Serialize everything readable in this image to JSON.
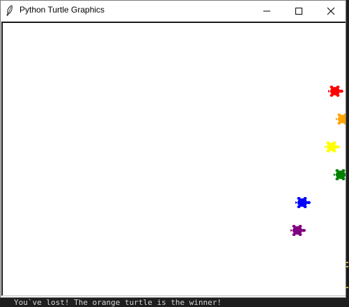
{
  "window": {
    "title": "Python Turtle Graphics"
  },
  "titlebar_icons": {
    "app": "feather-icon",
    "minimize": "minimize-icon",
    "maximize": "maximize-icon",
    "close": "close-icon"
  },
  "turtles": [
    {
      "name": "red",
      "color": "#ff0000"
    },
    {
      "name": "orange",
      "color": "#ffa500"
    },
    {
      "name": "yellow",
      "color": "#ffff00"
    },
    {
      "name": "green",
      "color": "#008000"
    },
    {
      "name": "blue",
      "color": "#0000ff"
    },
    {
      "name": "purple",
      "color": "#800080"
    }
  ],
  "terminal": {
    "output": "You`ve lost! The orange turtle is the winner!"
  }
}
